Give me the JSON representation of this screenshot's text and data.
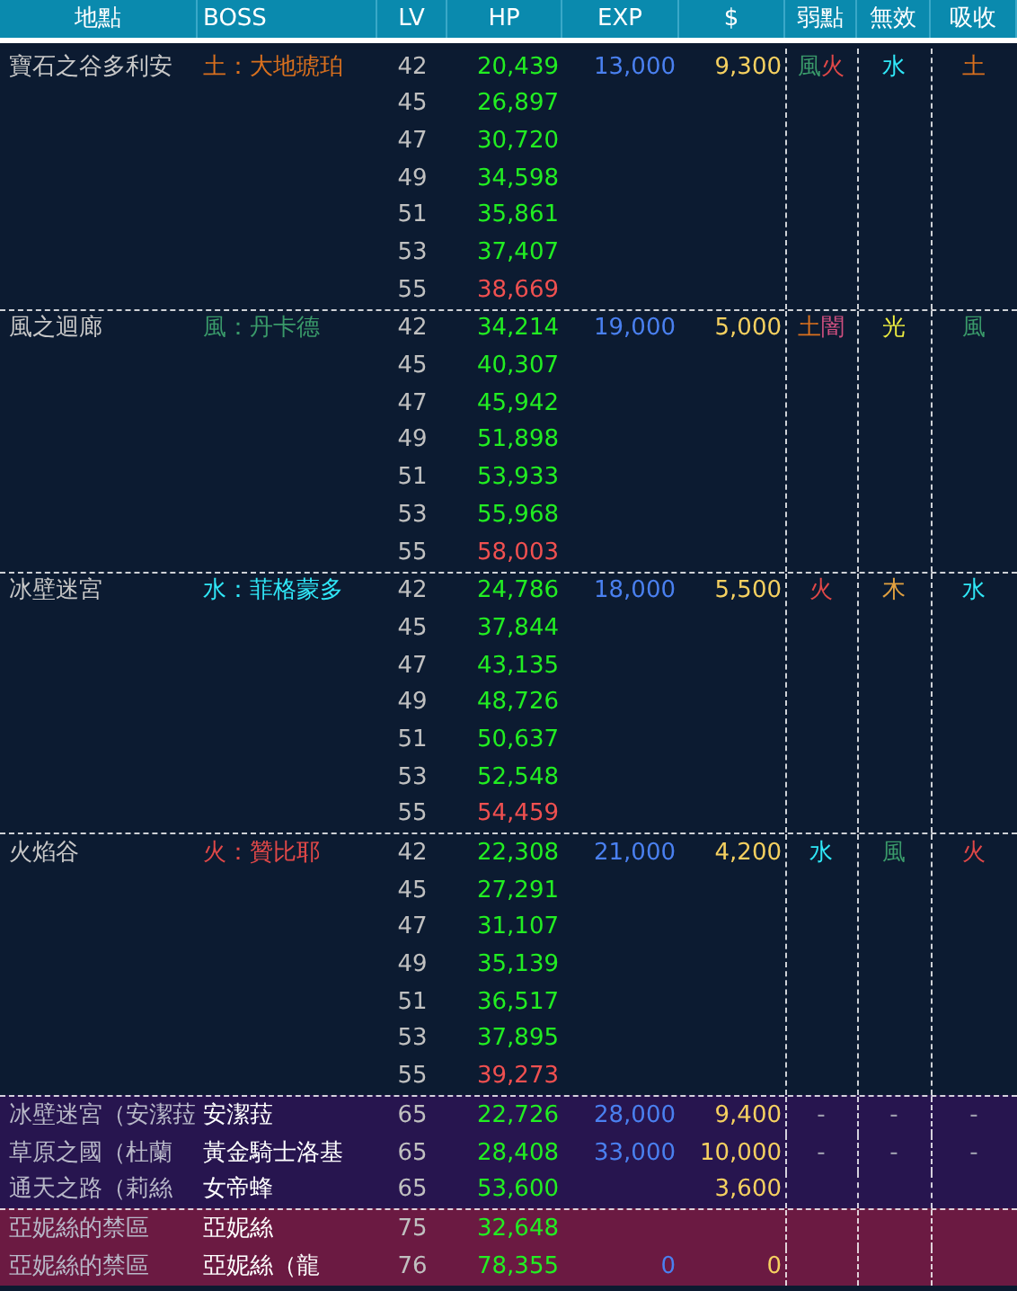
{
  "columns": [
    "地點",
    "BOSS",
    "LV",
    "HP",
    "EXP",
    "$",
    "弱點",
    "無效",
    "吸收"
  ],
  "groups": [
    {
      "kind": "normal",
      "location": "寶石之谷多利安",
      "boss": "土：大地琥珀",
      "color": "#d9701e",
      "exp": "13,000",
      "money": "9,300",
      "weak": [
        {
          "text": "風",
          "color": "#3a9a6a"
        },
        {
          "text": "火",
          "color": "#e04848"
        }
      ],
      "immune": [
        {
          "text": "水",
          "color": "#30e8f8"
        }
      ],
      "absorb": [
        {
          "text": "土",
          "color": "#d9701e"
        }
      ],
      "levels": [
        {
          "lv": "42",
          "hp": "20,439",
          "highlight": false
        },
        {
          "lv": "45",
          "hp": "26,897",
          "highlight": false
        },
        {
          "lv": "47",
          "hp": "30,720",
          "highlight": false
        },
        {
          "lv": "49",
          "hp": "34,598",
          "highlight": false
        },
        {
          "lv": "51",
          "hp": "35,861",
          "highlight": false
        },
        {
          "lv": "53",
          "hp": "37,407",
          "highlight": false
        },
        {
          "lv": "55",
          "hp": "38,669",
          "highlight": true
        }
      ]
    },
    {
      "kind": "normal",
      "location": "風之迴廊",
      "boss": "風：丹卡德",
      "color": "#3a9a6a",
      "exp": "19,000",
      "money": "5,000",
      "weak": [
        {
          "text": "土",
          "color": "#d9701e"
        },
        {
          "text": "闇",
          "color": "#d05080"
        }
      ],
      "immune": [
        {
          "text": "光",
          "color": "#f0f040"
        }
      ],
      "absorb": [
        {
          "text": "風",
          "color": "#3a9a6a"
        }
      ],
      "levels": [
        {
          "lv": "42",
          "hp": "34,214",
          "highlight": false
        },
        {
          "lv": "45",
          "hp": "40,307",
          "highlight": false
        },
        {
          "lv": "47",
          "hp": "45,942",
          "highlight": false
        },
        {
          "lv": "49",
          "hp": "51,898",
          "highlight": false
        },
        {
          "lv": "51",
          "hp": "53,933",
          "highlight": false
        },
        {
          "lv": "53",
          "hp": "55,968",
          "highlight": false
        },
        {
          "lv": "55",
          "hp": "58,003",
          "highlight": true
        }
      ]
    },
    {
      "kind": "normal",
      "location": "冰壁迷宮",
      "boss": "水：菲格蒙多",
      "color": "#30e8f8",
      "exp": "18,000",
      "money": "5,500",
      "weak": [
        {
          "text": "火",
          "color": "#e04848"
        }
      ],
      "immune": [
        {
          "text": "木",
          "color": "#e0a040"
        }
      ],
      "absorb": [
        {
          "text": "水",
          "color": "#30e8f8"
        }
      ],
      "levels": [
        {
          "lv": "42",
          "hp": "24,786",
          "highlight": false
        },
        {
          "lv": "45",
          "hp": "37,844",
          "highlight": false
        },
        {
          "lv": "47",
          "hp": "43,135",
          "highlight": false
        },
        {
          "lv": "49",
          "hp": "48,726",
          "highlight": false
        },
        {
          "lv": "51",
          "hp": "50,637",
          "highlight": false
        },
        {
          "lv": "53",
          "hp": "52,548",
          "highlight": false
        },
        {
          "lv": "55",
          "hp": "54,459",
          "highlight": true
        }
      ]
    },
    {
      "kind": "normal",
      "location": "火焰谷",
      "boss": "火：贊比耶",
      "color": "#e04848",
      "exp": "21,000",
      "money": "4,200",
      "weak": [
        {
          "text": "水",
          "color": "#30e8f8"
        }
      ],
      "immune": [
        {
          "text": "風",
          "color": "#3a9a6a"
        }
      ],
      "absorb": [
        {
          "text": "火",
          "color": "#e04848"
        }
      ],
      "levels": [
        {
          "lv": "42",
          "hp": "22,308",
          "highlight": false
        },
        {
          "lv": "45",
          "hp": "27,291",
          "highlight": false
        },
        {
          "lv": "47",
          "hp": "31,107",
          "highlight": false
        },
        {
          "lv": "49",
          "hp": "35,139",
          "highlight": false
        },
        {
          "lv": "51",
          "hp": "36,517",
          "highlight": false
        },
        {
          "lv": "53",
          "hp": "37,895",
          "highlight": false
        },
        {
          "lv": "55",
          "hp": "39,273",
          "highlight": true
        }
      ]
    },
    {
      "kind": "purple",
      "location": "冰壁迷宮（安潔菈",
      "boss": "安潔菈",
      "exp": "28,000",
      "money": "9,400",
      "weak": [
        {
          "text": "-",
          "color": "#a0a0b0"
        }
      ],
      "immune": [
        {
          "text": "-",
          "color": "#a0a0b0"
        }
      ],
      "absorb": [
        {
          "text": "-",
          "color": "#a0a0b0"
        }
      ],
      "levels": [
        {
          "lv": "65",
          "hp": "22,726",
          "highlight": false
        }
      ]
    },
    {
      "kind": "purple",
      "location": "草原之國（杜蘭",
      "boss": "黃金騎士洛基",
      "exp": "33,000",
      "money": "10,000",
      "weak": [
        {
          "text": "-",
          "color": "#a0a0b0"
        }
      ],
      "immune": [
        {
          "text": "-",
          "color": "#a0a0b0"
        }
      ],
      "absorb": [
        {
          "text": "-",
          "color": "#a0a0b0"
        }
      ],
      "levels": [
        {
          "lv": "65",
          "hp": "28,408",
          "highlight": false
        }
      ]
    },
    {
      "kind": "purple",
      "location": "通天之路（莉絲",
      "boss": "女帝蜂",
      "money": "3,600",
      "levels": [
        {
          "lv": "65",
          "hp": "53,600",
          "highlight": false
        }
      ]
    },
    {
      "kind": "crimson",
      "location": "亞妮絲的禁區",
      "boss": "亞妮絲",
      "levels": [
        {
          "lv": "75",
          "hp": "32,648",
          "highlight": false
        }
      ]
    },
    {
      "kind": "crimson",
      "location": "亞妮絲的禁區",
      "boss": "亞妮絲（龍",
      "exp": "0",
      "money": "0",
      "levels": [
        {
          "lv": "76",
          "hp": "78,355",
          "highlight": false
        }
      ]
    }
  ]
}
